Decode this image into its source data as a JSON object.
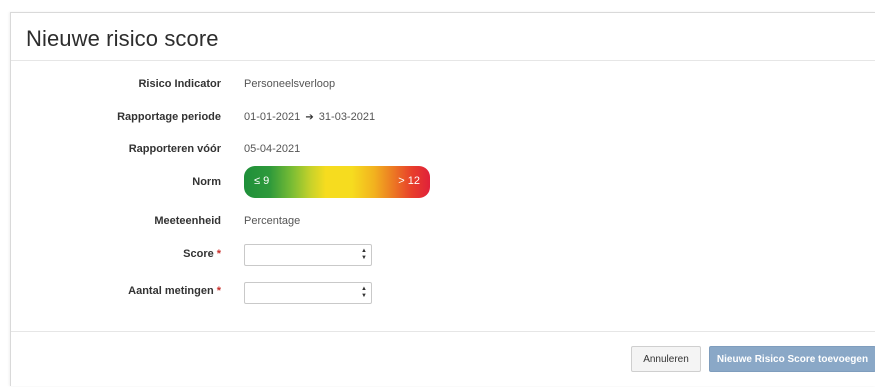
{
  "modal": {
    "title": "Nieuwe risico score"
  },
  "fields": {
    "indicator": {
      "label": "Risico Indicator",
      "value": "Personeelsverloop"
    },
    "period": {
      "label": "Rapportage periode",
      "from": "01-01-2021",
      "to": "31-03-2021",
      "arrow": "➔"
    },
    "due": {
      "label": "Rapporteren vóór",
      "value": "05-04-2021"
    },
    "norm": {
      "label": "Norm",
      "low": "≤ 9",
      "high": "> 12"
    },
    "unit": {
      "label": "Meeteenheid",
      "value": "Percentage"
    },
    "score": {
      "label": "Score",
      "required_mark": "*",
      "value": ""
    },
    "measurements": {
      "label": "Aantal metingen",
      "required_mark": "*",
      "value": ""
    }
  },
  "buttons": {
    "cancel": "Annuleren",
    "submit": "Nieuwe Risico Score toevoegen"
  },
  "icons": {
    "spinner_up": "▲",
    "spinner_down": "▼"
  },
  "colors": {
    "primary_button": "#8aa8c7",
    "required": "#c9302c",
    "norm_low": "#1e8f3a",
    "norm_mid": "#f6dc1f",
    "norm_high": "#e0203a"
  }
}
